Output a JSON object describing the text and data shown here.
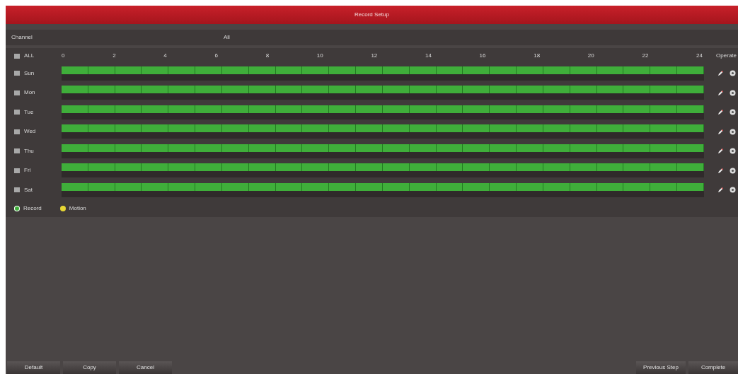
{
  "window": {
    "title": "Record Setup"
  },
  "channel": {
    "label": "Channel",
    "value": "All"
  },
  "header": {
    "all_label": "ALL",
    "all_checked": false,
    "hours": [
      "0",
      "2",
      "4",
      "6",
      "8",
      "10",
      "12",
      "14",
      "16",
      "18",
      "20",
      "22",
      "24"
    ],
    "operate": "Operate"
  },
  "days": [
    {
      "label": "Sun",
      "checked": false,
      "level": 1
    },
    {
      "label": "Mon",
      "checked": false,
      "level": 1
    },
    {
      "label": "Tue",
      "checked": false,
      "level": 1
    },
    {
      "label": "Wed",
      "checked": false,
      "level": 1
    },
    {
      "label": "Thu",
      "checked": false,
      "level": 1
    },
    {
      "label": "Fri",
      "checked": false,
      "level": 1
    },
    {
      "label": "Sat",
      "checked": false,
      "level": 1
    }
  ],
  "legend": [
    {
      "label": "Record",
      "color": "#3fae3a",
      "selected": true
    },
    {
      "label": "Motion",
      "color": "#e6d634",
      "selected": false
    }
  ],
  "buttons_left": [
    "Default",
    "Copy",
    "Cancel"
  ],
  "buttons_right": [
    "Previous Step",
    "Complete"
  ]
}
